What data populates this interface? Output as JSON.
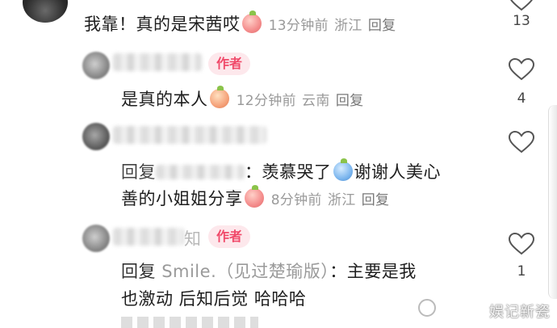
{
  "comments": [
    {
      "text": "我靠！真的是宋茜哎",
      "emoji": "heart-eyes-emoji",
      "time": "13分钟前",
      "location": "浙江",
      "reply": "回复",
      "likes": "13"
    },
    {
      "author_tag": "作者",
      "text": "是真的本人",
      "emoji": "sweat-emoji",
      "time": "12分钟前",
      "location": "云南",
      "reply": "回复",
      "likes": "4"
    },
    {
      "reply_prefix": "回复",
      "text_1": "：羡慕哭了",
      "emoji_1": "crying-emoji",
      "text_2": "谢谢人美心",
      "text_3": "善的小姐姐分享",
      "emoji_2": "love-emoji",
      "time": "8分钟前",
      "location": "浙江",
      "reply": "回复"
    },
    {
      "name_suffix": "知",
      "author_tag": "作者",
      "reply_prefix": "回复",
      "reply_to": "Smile.（见过楚瑜版）",
      "text_1": "：主要是我",
      "text_2": "也激动 后知后觉 哈哈哈",
      "likes": "1"
    }
  ],
  "watermark": "娱记新瓷"
}
